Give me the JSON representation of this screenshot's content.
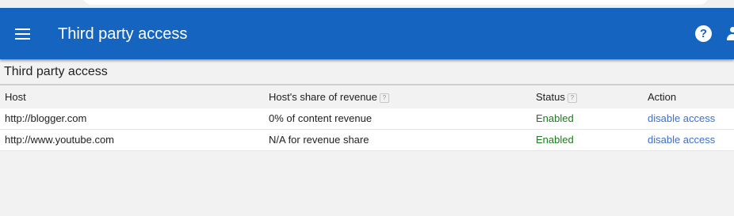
{
  "header": {
    "title": "Third party access",
    "menu_icon": "menu-icon",
    "help_icon": "help-icon",
    "help_glyph": "?",
    "account_icon": "account-icon",
    "brand_color": "#1565c0"
  },
  "section": {
    "title": "Third party access"
  },
  "table": {
    "columns": {
      "host": "Host",
      "share": "Host's share of revenue",
      "status": "Status",
      "action": "Action"
    },
    "help_glyph": "?",
    "rows": [
      {
        "host": "http://blogger.com",
        "share": "0% of content revenue",
        "status": "Enabled",
        "action": "disable access"
      },
      {
        "host": "http://www.youtube.com",
        "share": "N/A for revenue share",
        "status": "Enabled",
        "action": "disable access"
      }
    ],
    "status_color": "#1b7a1b",
    "link_color": "#3b6fcf"
  }
}
